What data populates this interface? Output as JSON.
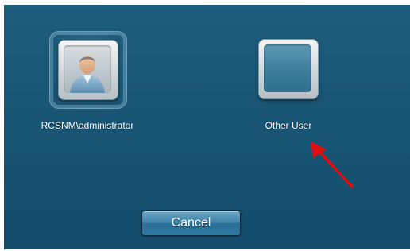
{
  "users": [
    {
      "label": "RCSNM\\administrator",
      "icon": "user-avatar-icon",
      "selected": true
    },
    {
      "label": "Other User",
      "icon": "blank-user-icon",
      "selected": false
    }
  ],
  "cancel_label": "Cancel",
  "colors": {
    "background": "#185574",
    "annotation_arrow": "#e01010"
  }
}
